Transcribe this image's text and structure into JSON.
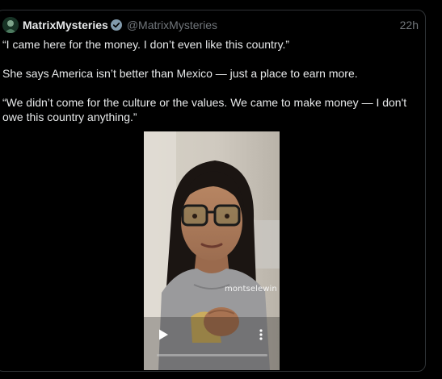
{
  "tweet": {
    "display_name": "MatrixMysteries",
    "handle": "@MatrixMysteries",
    "time": "22h",
    "verified": true,
    "paragraphs": [
      "“I came here for the money. I don’t even like this country.”",
      "She says America isn’t better than Mexico — just a place to earn more.",
      "“We didn’t come for the culture or the values. We came to make money — I don't owe this country anything.”"
    ]
  },
  "video": {
    "watermark": "montselewin",
    "progress": 0.0,
    "play_icon": "play-icon",
    "more_icon": "more-vertical-icon"
  },
  "colors": {
    "background": "#000000",
    "text": "#e7e9ea",
    "muted": "#71767b",
    "border": "#2f3336",
    "verified_badge": "#829aab"
  }
}
